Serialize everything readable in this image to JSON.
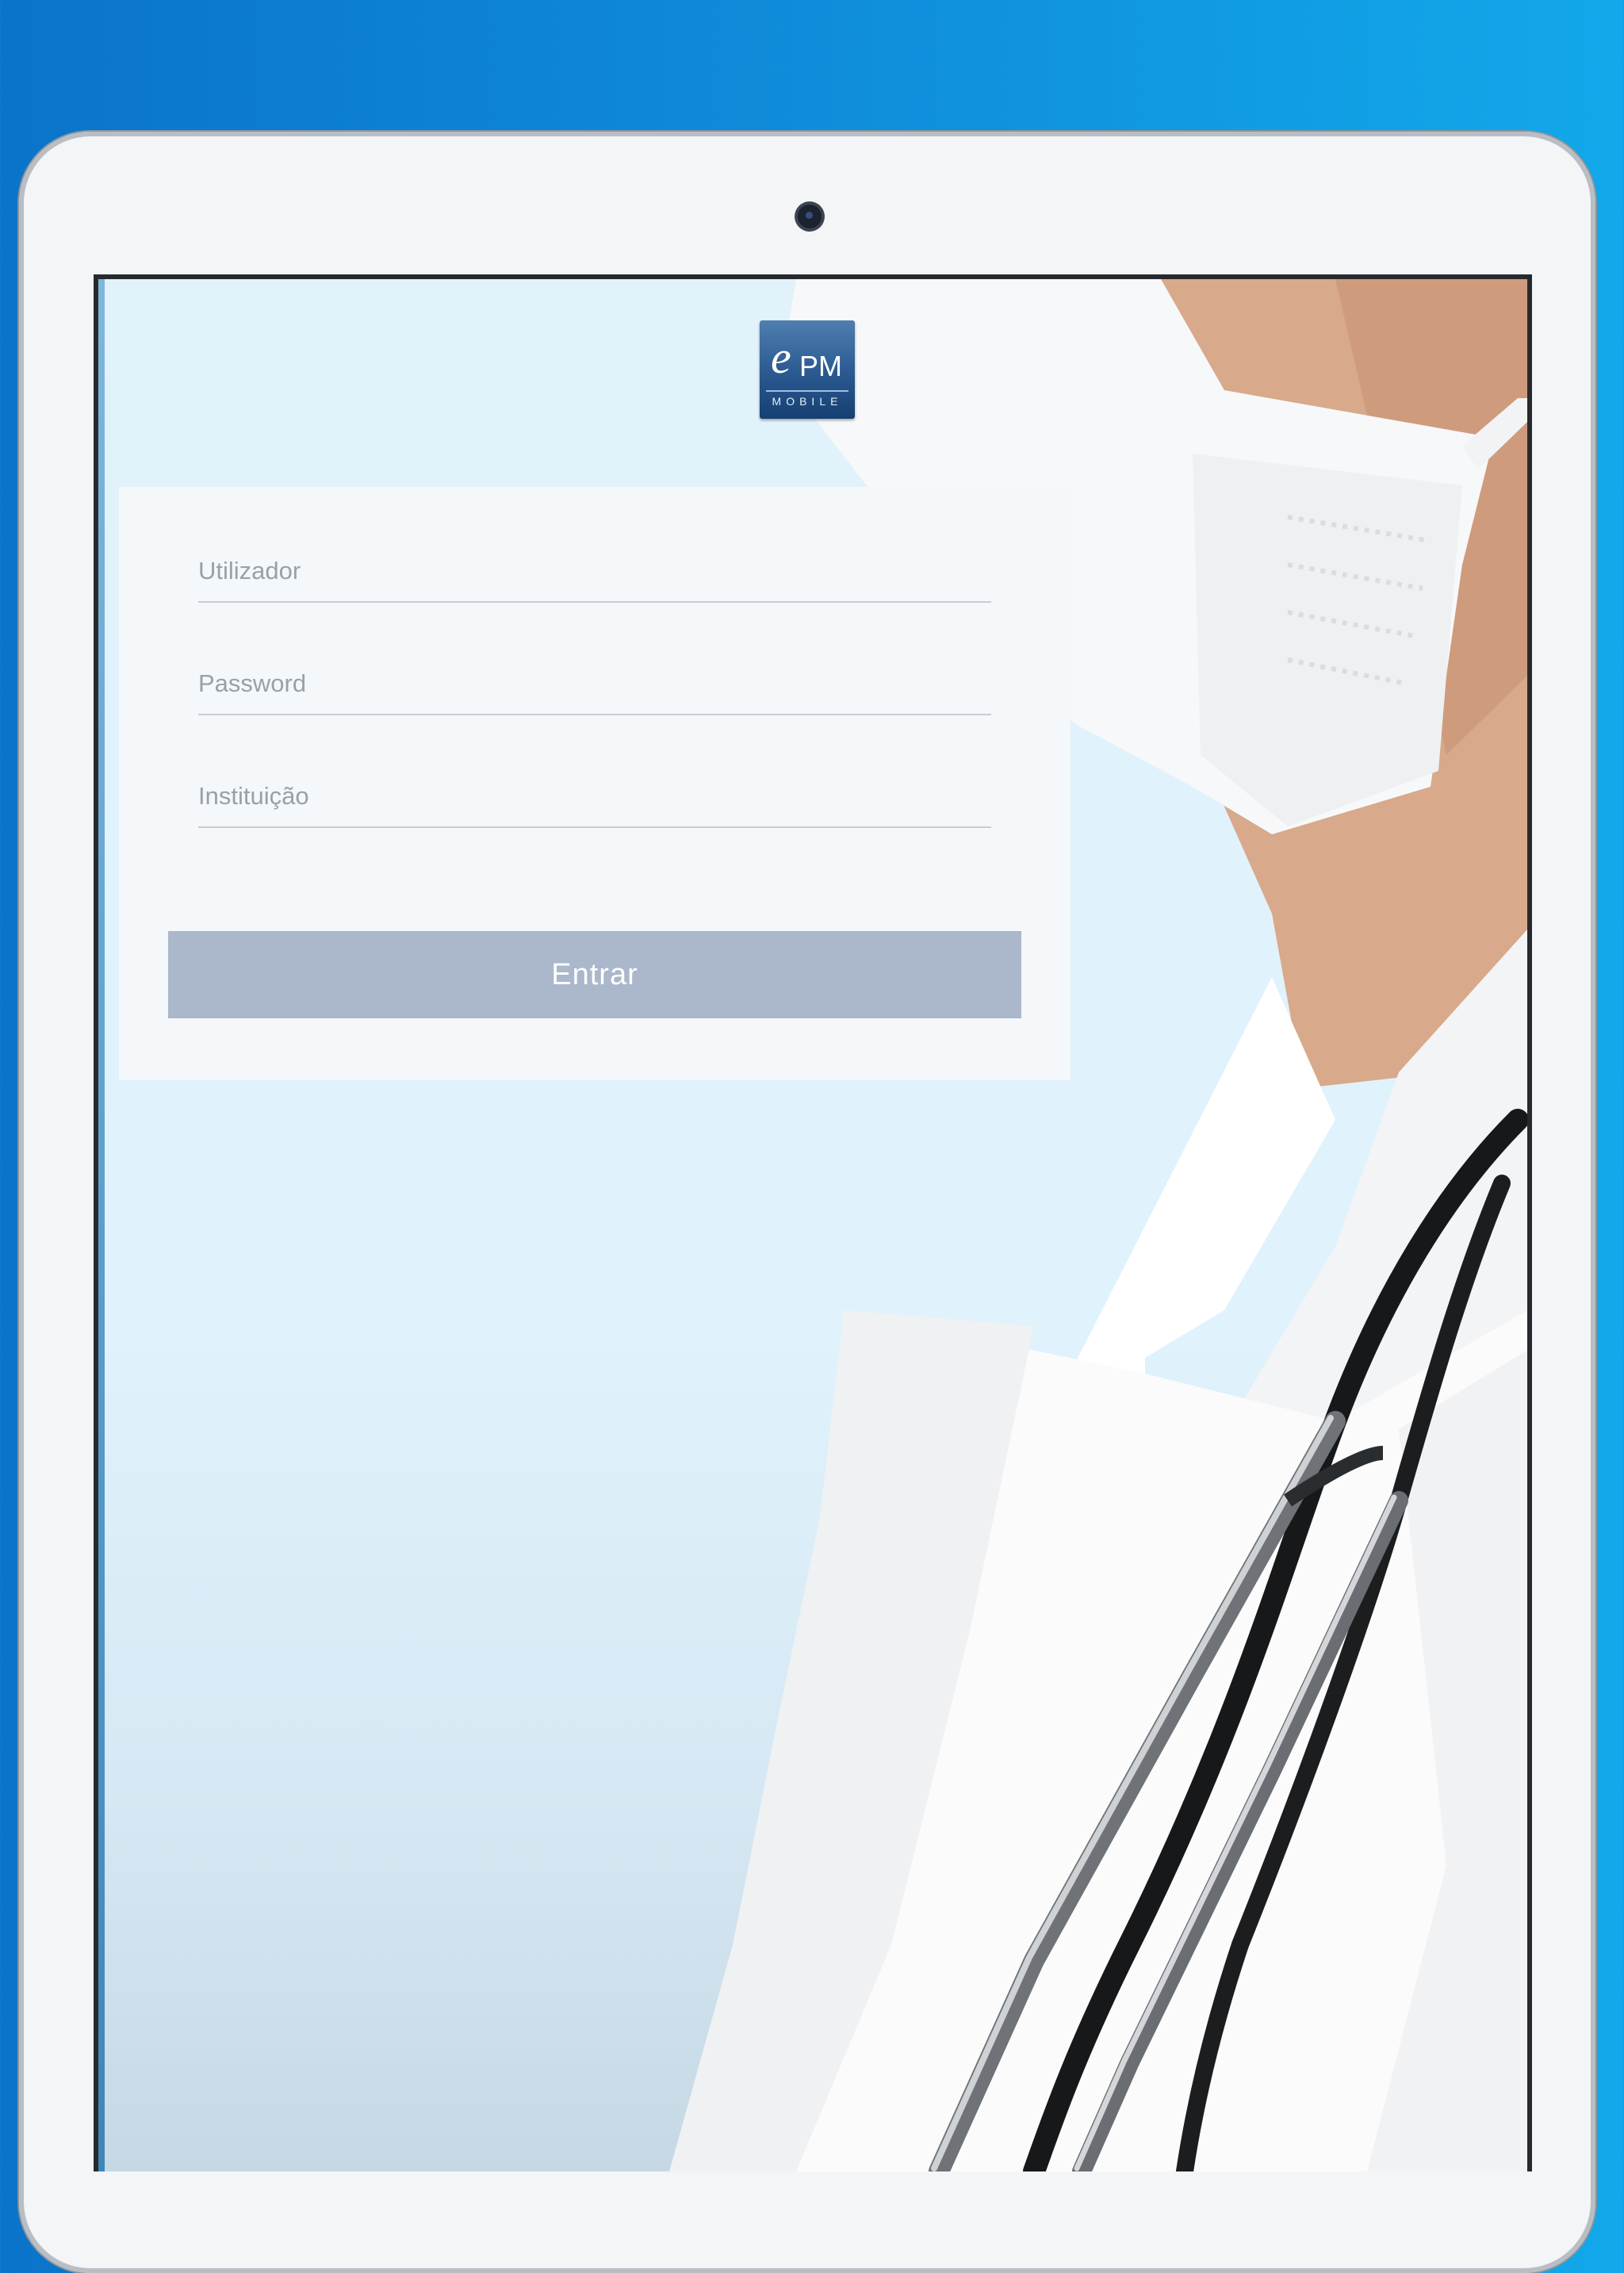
{
  "app": {
    "logo": {
      "letter": "e",
      "initials": "PM",
      "subtitle": "MOBILE"
    }
  },
  "login": {
    "username_placeholder": "Utilizador",
    "password_placeholder": "Password",
    "institution_placeholder": "Instituição",
    "submit_label": "Entrar"
  },
  "colors": {
    "background_blue": "#0a74c9",
    "button": "#abb7cb",
    "card": "#f5f8fa"
  }
}
